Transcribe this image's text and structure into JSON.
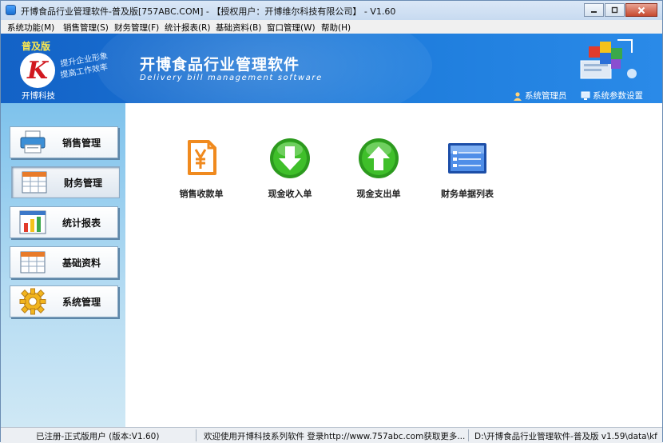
{
  "window": {
    "title": "开博食品行业管理软件-普及版[757ABC.COM] - 【授权用户：开博维尔科技有限公司】 - V1.60",
    "controls": [
      "minimize-icon",
      "restore-icon",
      "close-icon"
    ]
  },
  "menu": [
    "系统功能(M)",
    "销售管理(S)",
    "财务管理(F)",
    "统计报表(R)",
    "基础资料(B)",
    "窗口管理(W)",
    "帮助(H)"
  ],
  "banner": {
    "edition": "普及版",
    "company": "开博科技",
    "slogan_1": "提升企业形象",
    "slogan_2": "提高工作效率",
    "app_title": "开博食品行业管理软件",
    "app_subtitle": "Delivery bill management software",
    "user_link": "系统管理员",
    "settings_link": "系统参数设置"
  },
  "sidebar": [
    {
      "label": "销售管理",
      "icon": "printer-icon",
      "active": false
    },
    {
      "label": "财务管理",
      "icon": "ledger-icon",
      "active": true
    },
    {
      "label": "统计报表",
      "icon": "bar-chart-icon",
      "active": false
    },
    {
      "label": "基础资料",
      "icon": "table-icon",
      "active": false
    },
    {
      "label": "系统管理",
      "icon": "gear-icon",
      "active": false
    }
  ],
  "tiles": [
    {
      "label": "销售收款单",
      "icon": "yen-receipt-icon"
    },
    {
      "label": "现金收入单",
      "icon": "arrow-down-icon"
    },
    {
      "label": "现金支出单",
      "icon": "arrow-up-icon"
    },
    {
      "label": "财务单据列表",
      "icon": "list-window-icon"
    }
  ],
  "status": {
    "registration": "已注册-正式版用户 (版本:V1.60)",
    "welcome": "欢迎使用开博科技系列软件  登录http://www.757abc.com获取更多...",
    "path": "D:\\开博食品行业管理软件-普及版 v1.59\\data\\kf"
  },
  "colors": {
    "banner_blue": "#1d7bdb",
    "sidebar_blue": "#7ec2ec",
    "edition_yellow": "#ffea4d",
    "logo_red": "#d1181f",
    "tile_green": "#2c9a1e",
    "tile_orange": "#f08a1e"
  }
}
